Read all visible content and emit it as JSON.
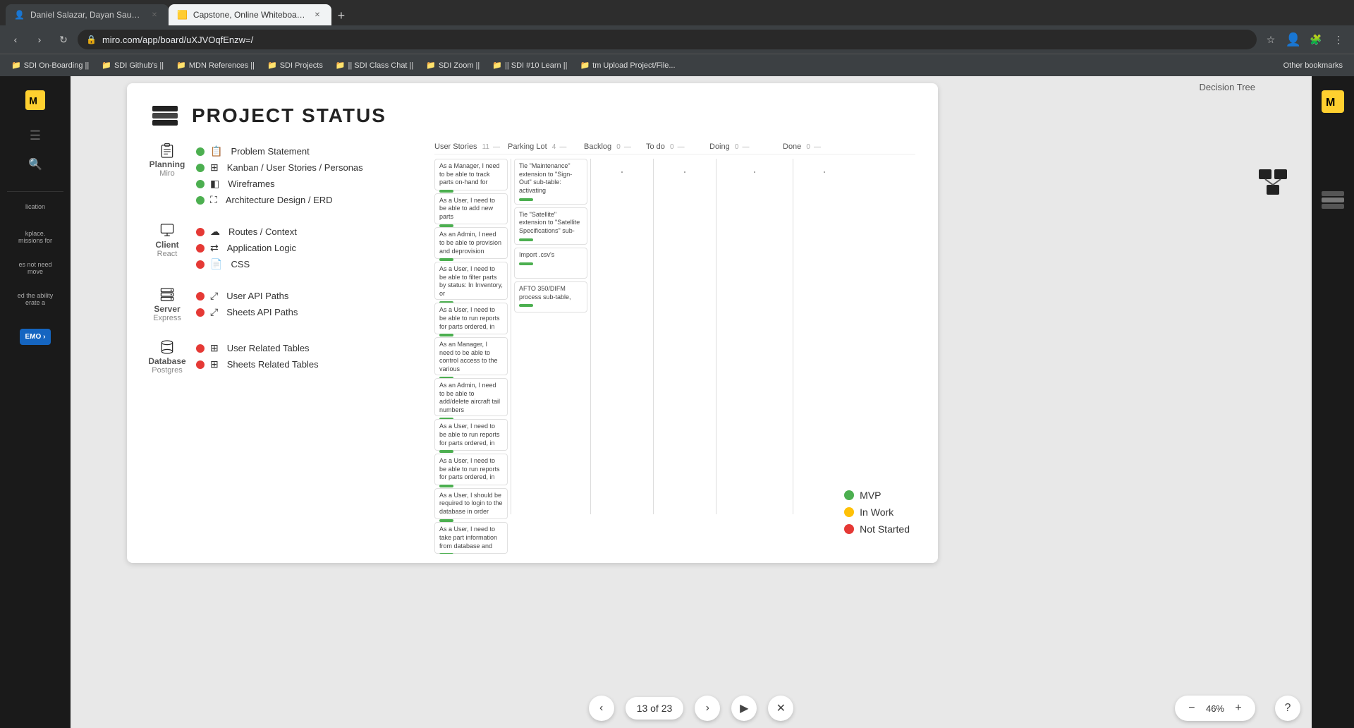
{
  "browser": {
    "tabs": [
      {
        "id": "tab1",
        "title": "Daniel Salazar, Dayan Sauerbron...",
        "url": "",
        "active": false,
        "favicon": "👤"
      },
      {
        "id": "tab2",
        "title": "Capstone, Online Whiteboard fo...",
        "url": "miro.com/app/board/uXJVOqfEnzw=/",
        "active": true,
        "favicon": "🟨"
      }
    ],
    "address": "miro.com/app/board/uXJVOqfEnzw=/",
    "bookmarks": [
      {
        "label": "SDI On-Boarding ||"
      },
      {
        "label": "SDI Github's ||"
      },
      {
        "label": "MDN References ||"
      },
      {
        "label": "SDI Projects"
      },
      {
        "label": "|| SDI Class Chat ||"
      },
      {
        "label": "SDI Zoom ||"
      },
      {
        "label": "|| SDI #10 Learn ||"
      },
      {
        "label": "tm  Upload Project/File..."
      }
    ],
    "other_bookmarks_label": "Other bookmarks"
  },
  "canvas": {
    "top_label": "Project Status",
    "decision_tree_label": "Decision Tree"
  },
  "project_status": {
    "title": "PROJECT STATUS",
    "sections": [
      {
        "id": "planning",
        "icon_label": "Planning",
        "sub_label": "Miro",
        "items": [
          {
            "status": "green",
            "icon": "clipboard",
            "text": "Problem Statement"
          },
          {
            "status": "green",
            "icon": "grid",
            "text": "Kanban / User Stories / Personas"
          },
          {
            "status": "green",
            "icon": "layers",
            "text": "Wireframes"
          },
          {
            "status": "green",
            "icon": "diagram",
            "text": "Architecture Design / ERD"
          }
        ]
      },
      {
        "id": "client",
        "icon_label": "Client",
        "sub_label": "React",
        "items": [
          {
            "status": "red",
            "icon": "cloud",
            "text": "Routes / Context"
          },
          {
            "status": "red",
            "icon": "logic",
            "text": "Application Logic"
          },
          {
            "status": "red",
            "icon": "css",
            "text": "CSS"
          }
        ]
      },
      {
        "id": "server",
        "icon_label": "Server",
        "sub_label": "Express",
        "items": [
          {
            "status": "red",
            "icon": "api",
            "text": "User API Paths"
          },
          {
            "status": "red",
            "icon": "api",
            "text": "Sheets API Paths"
          }
        ]
      },
      {
        "id": "database",
        "icon_label": "Database",
        "sub_label": "Postgres",
        "items": [
          {
            "status": "red",
            "icon": "table",
            "text": "User Related Tables"
          },
          {
            "status": "red",
            "icon": "table",
            "text": "Sheets Related Tables"
          }
        ]
      }
    ],
    "kanban": {
      "columns": [
        {
          "id": "user-stories",
          "label": "User Stories",
          "count": "11",
          "separator": "—"
        },
        {
          "id": "parking-lot",
          "label": "Parking Lot",
          "count": "4",
          "separator": "—"
        },
        {
          "id": "backlog",
          "label": "Backlog",
          "count": "0",
          "separator": "—"
        },
        {
          "id": "todo",
          "label": "To do",
          "count": "0",
          "separator": "—"
        },
        {
          "id": "doing",
          "label": "Doing",
          "count": "0",
          "separator": "—"
        },
        {
          "id": "done",
          "label": "Done",
          "count": "0",
          "separator": "—"
        }
      ],
      "user_stories_cards": [
        "As a Manager, I need to be able to track parts on-hand for",
        "As a User, I need to be able to add new parts",
        "As an Admin, I need to be able to provision and deprovision",
        "As a User, I need to be able to filter parts by status: In Inventory, or",
        "As a User, I need to be able to run reports for parts ordered, in",
        "As an Manager, I need to be able to control access to the various",
        "As an Admin, I need to be able to add/delete aircraft tail numbers",
        "As a User, I need to be able to run reports for parts ordered, in",
        "As a User, I need to be able to run reports for parts ordered, in",
        "As a User, I should be required to login to the database in order",
        "As a User, I need to take part information from database and"
      ],
      "parking_lot_cards": [
        "Tie \"Maintenance\" extension to \"Sign-Out\" sub-table: activating",
        "Tie \"Satellite\" extension to \"Satellite Specifications\" sub-",
        "Import .csv's",
        "AFTO 350/DIFM process sub-table,"
      ]
    },
    "legend": [
      {
        "color": "#4caf50",
        "label": "MVP"
      },
      {
        "color": "#ffc107",
        "label": "In Work"
      },
      {
        "color": "#e53935",
        "label": "Not Started"
      }
    ]
  },
  "bottom_toolbar": {
    "prev_label": "‹",
    "page_indicator": "13 of 23",
    "next_label": "›",
    "play_label": "▶",
    "close_label": "✕"
  },
  "zoom": {
    "minus_label": "−",
    "level": "46%",
    "plus_label": "+"
  },
  "help": {
    "label": "?"
  },
  "left_panel": {
    "items": [
      {
        "text": "lication"
      },
      {
        "text": "kplace.\nmissions for"
      },
      {
        "text": "es not need\nmove"
      },
      {
        "text": "ed the ability\nerate a"
      }
    ]
  }
}
